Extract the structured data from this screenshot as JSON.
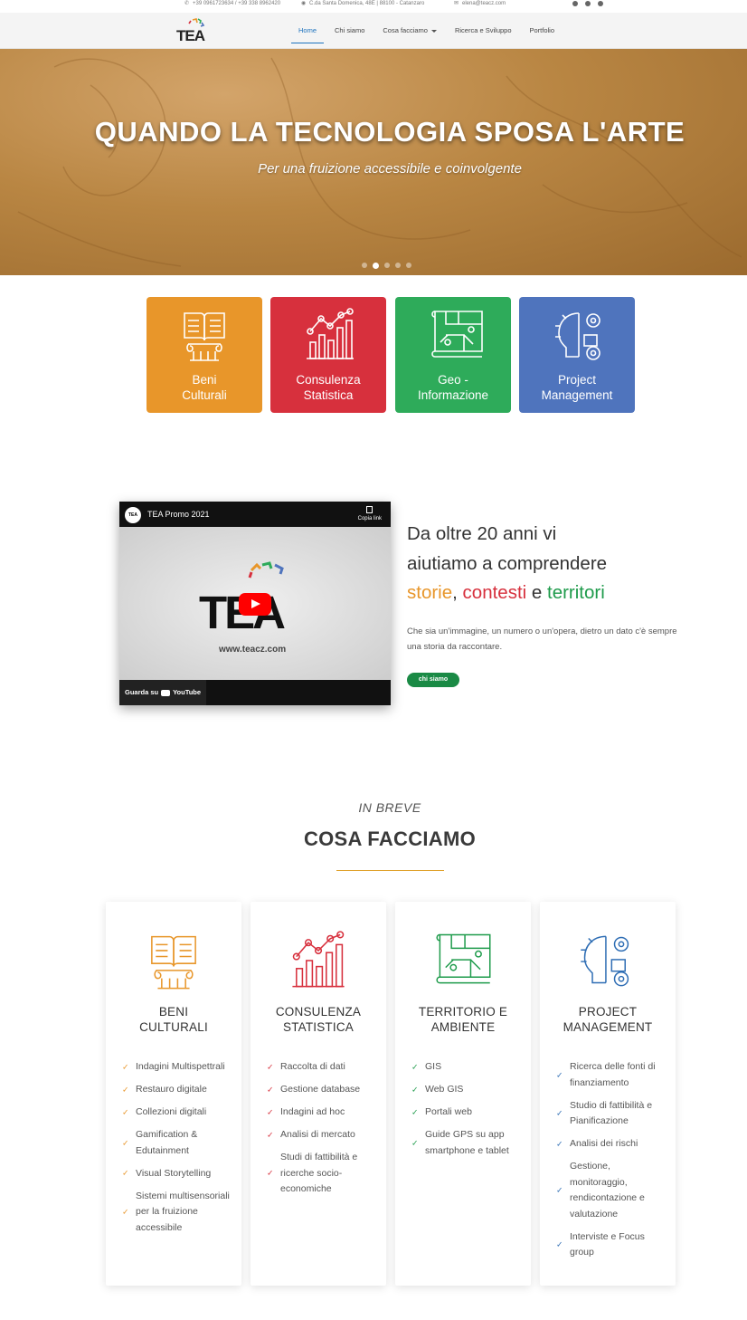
{
  "topbar": {
    "phone": "+39 0961723634 / +39 338 8962420",
    "address": "C.da Santa Domenica, 48E | 88100 - Catanzaro",
    "email": "elena@teacz.com",
    "social": [
      "facebook-icon",
      "instagram-icon",
      "linkedin-icon"
    ]
  },
  "navbar": {
    "logo_text": "TEA",
    "items": [
      {
        "label": "Home",
        "active": true
      },
      {
        "label": "Chi siamo"
      },
      {
        "label": "Cosa facciamo",
        "dropdown": true
      },
      {
        "label": "Ricerca e Sviluppo"
      },
      {
        "label": "Portfolio"
      }
    ]
  },
  "hero": {
    "title": "QUANDO LA TECNOLOGIA SPOSA L'ARTE",
    "subtitle": "Per una fruizione accessibile e coinvolgente",
    "slides": 5,
    "active_slide": 2
  },
  "tiles": [
    {
      "line1": "Beni",
      "line2": "Culturali",
      "color": "#e8962a",
      "icon": "book-column-icon"
    },
    {
      "line1": "Consulenza",
      "line2": "Statistica",
      "color": "#d7303d",
      "icon": "bar-chart-icon"
    },
    {
      "line1": "Geo -",
      "line2": "Informazione",
      "color": "#2eab5a",
      "icon": "map-icon"
    },
    {
      "line1": "Project",
      "line2": "Management",
      "color": "#4f74bd",
      "icon": "brain-gears-icon"
    }
  ],
  "video": {
    "title": "TEA Promo 2021",
    "channel_logo": "TEA",
    "copy_link": "Copia link",
    "brand": "TEA",
    "url": "www.teacz.com",
    "watch_on": "Guarda su",
    "youtube": "YouTube"
  },
  "intro": {
    "line1": "Da oltre 20 anni vi",
    "line2": "aiutiamo a comprendere",
    "word1": "storie",
    "sep1": ", ",
    "word2": "contesti",
    "sep2": " e ",
    "word3": "territori",
    "body": "Che sia un'immagine, un numero o un'opera, dietro un dato c'è sempre una storia da raccontare.",
    "button": "chi siamo"
  },
  "section": {
    "kicker": "IN BREVE",
    "title": "COSA FACCIAMO"
  },
  "cards": [
    {
      "title1": "BENI",
      "title2": "CULTURALI",
      "color": "#e8962a",
      "icon": "book-column-icon",
      "items": [
        "Indagini Multispettrali",
        "Restauro digitale",
        "Collezioni digitali",
        "Gamification & Edutainment",
        "Visual Storytelling",
        "Sistemi multisensoriali per la fruizione accessibile"
      ]
    },
    {
      "title1": "CONSULENZA",
      "title2": "STATISTICA",
      "color": "#d7303d",
      "icon": "bar-chart-icon",
      "items": [
        "Raccolta di dati",
        "Gestione database",
        "Indagini ad hoc",
        "Analisi di mercato",
        "Studi di fattibilità e ricerche socio-economiche"
      ]
    },
    {
      "title1": "TERRITORIO E",
      "title2": "AMBIENTE",
      "color": "#1e9b4b",
      "icon": "map-icon",
      "items": [
        "GIS",
        "Web GIS",
        "Portali web",
        "Guide GPS su app smartphone e tablet"
      ]
    },
    {
      "title1": "PROJECT",
      "title2": "MANAGEMENT",
      "color": "#2e6db4",
      "icon": "brain-gears-icon",
      "items": [
        "Ricerca delle fonti di finanziamento",
        "Studio di fattibilità e Pianificazione",
        "Analisi dei rischi",
        "Gestione, monitoraggio, rendicontazione e valutazione",
        "Interviste e Focus group"
      ]
    }
  ]
}
